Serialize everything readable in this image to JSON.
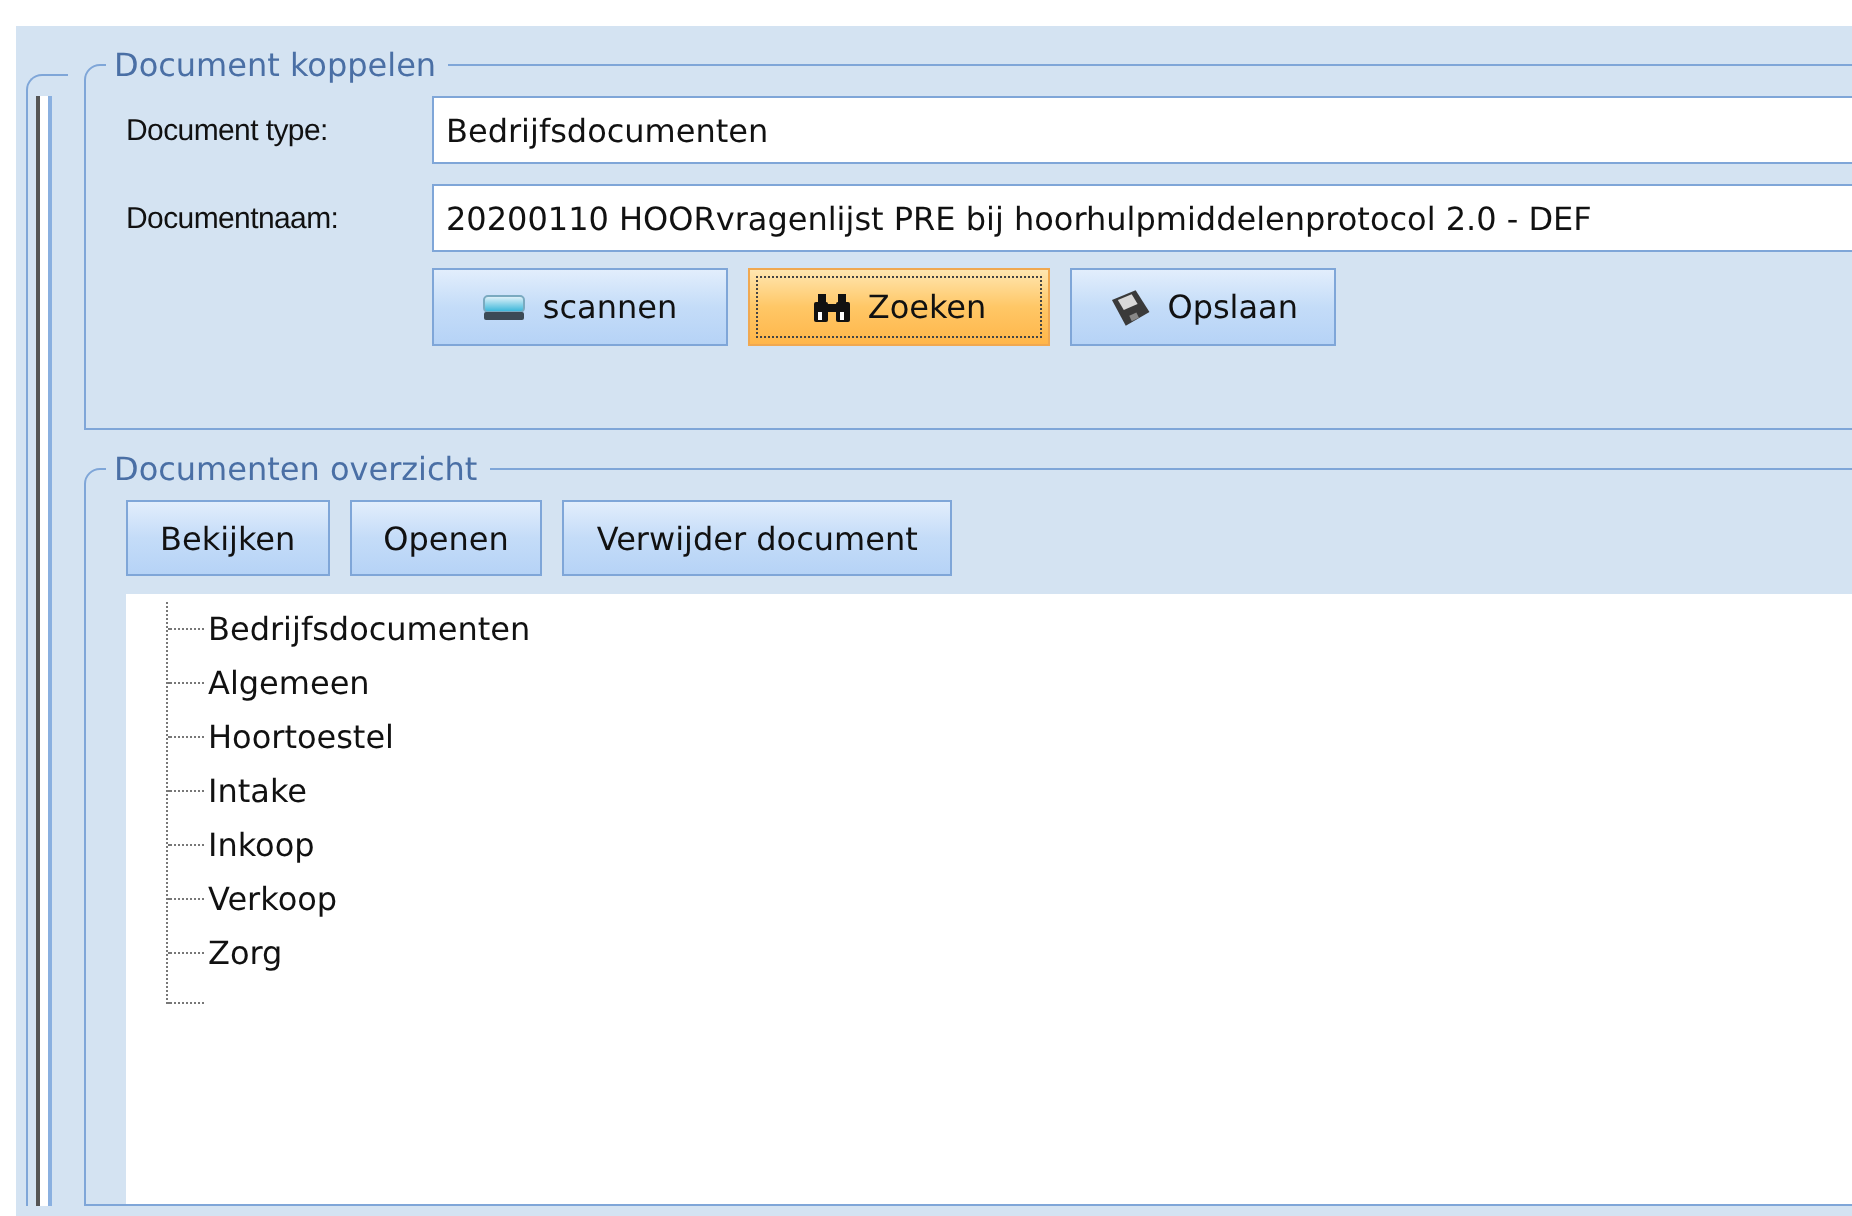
{
  "document_koppelen": {
    "legend": "Document koppelen",
    "fields": [
      {
        "label": "Document type:",
        "value": "Bedrijfsdocumenten"
      },
      {
        "label": "Documentnaam:",
        "value": "20200110 HOORvragenlijst PRE bij hoorhulpmiddelenprotocol 2.0 - DEF"
      }
    ],
    "buttons": [
      {
        "kind": "scanner",
        "label": "scannen",
        "focused": false
      },
      {
        "kind": "binoculars",
        "label": "Zoeken",
        "focused": true
      },
      {
        "kind": "floppy",
        "label": "Opslaan",
        "focused": false
      }
    ]
  },
  "documenten_overzicht": {
    "legend": "Documenten overzicht",
    "buttons": [
      {
        "label": "Bekijken"
      },
      {
        "label": "Openen"
      },
      {
        "label": "Verwijder document"
      }
    ],
    "tree": {
      "items": [
        {
          "label": "Bedrijfsdocumenten"
        },
        {
          "label": "Algemeen"
        },
        {
          "label": "Hoortoestel"
        },
        {
          "label": "Intake"
        },
        {
          "label": "Inkoop"
        },
        {
          "label": "Verkoop"
        },
        {
          "label": "Zorg"
        }
      ]
    }
  }
}
